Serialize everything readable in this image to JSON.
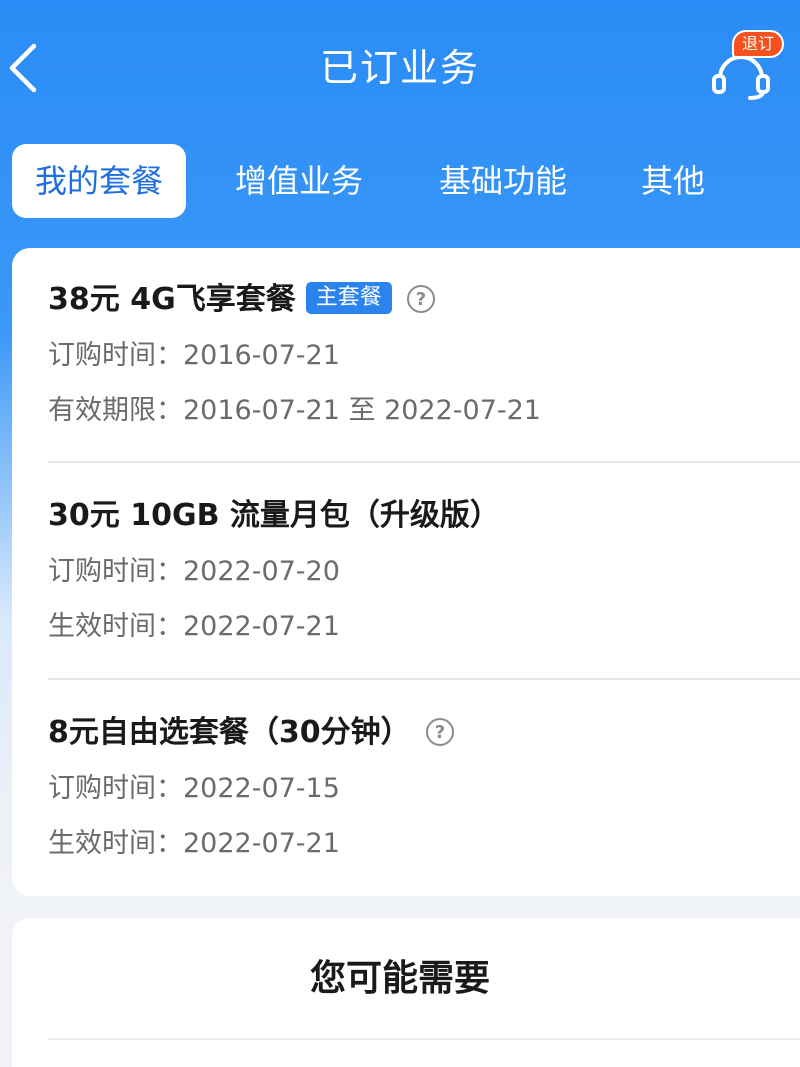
{
  "header": {
    "title": "已订业务",
    "unsubscribe_badge": "退订"
  },
  "tabs": [
    {
      "label": "我的套餐",
      "active": true
    },
    {
      "label": "增值业务",
      "active": false
    },
    {
      "label": "基础功能",
      "active": false
    },
    {
      "label": "其他",
      "active": false
    }
  ],
  "subscriptions": [
    {
      "name": "38元 4G飞享套餐",
      "tag": "主套餐",
      "rows": [
        "订购时间：2016-07-21",
        "有效期限：2016-07-21 至 2022-07-21"
      ]
    },
    {
      "name": "30元 10GB 流量月包（升级版）",
      "rows": [
        "订购时间：2022-07-20",
        "生效时间：2022-07-21"
      ]
    },
    {
      "name": "8元自由选套餐（30分钟）",
      "rows": [
        "订购时间：2022-07-15",
        "生效时间：2022-07-21"
      ]
    }
  ],
  "recommend": {
    "title": "您可能需要"
  },
  "colors": {
    "header_blue": "#2a8cf6",
    "tag_blue": "#2b83ee",
    "badge_orange": "#f4511e"
  }
}
